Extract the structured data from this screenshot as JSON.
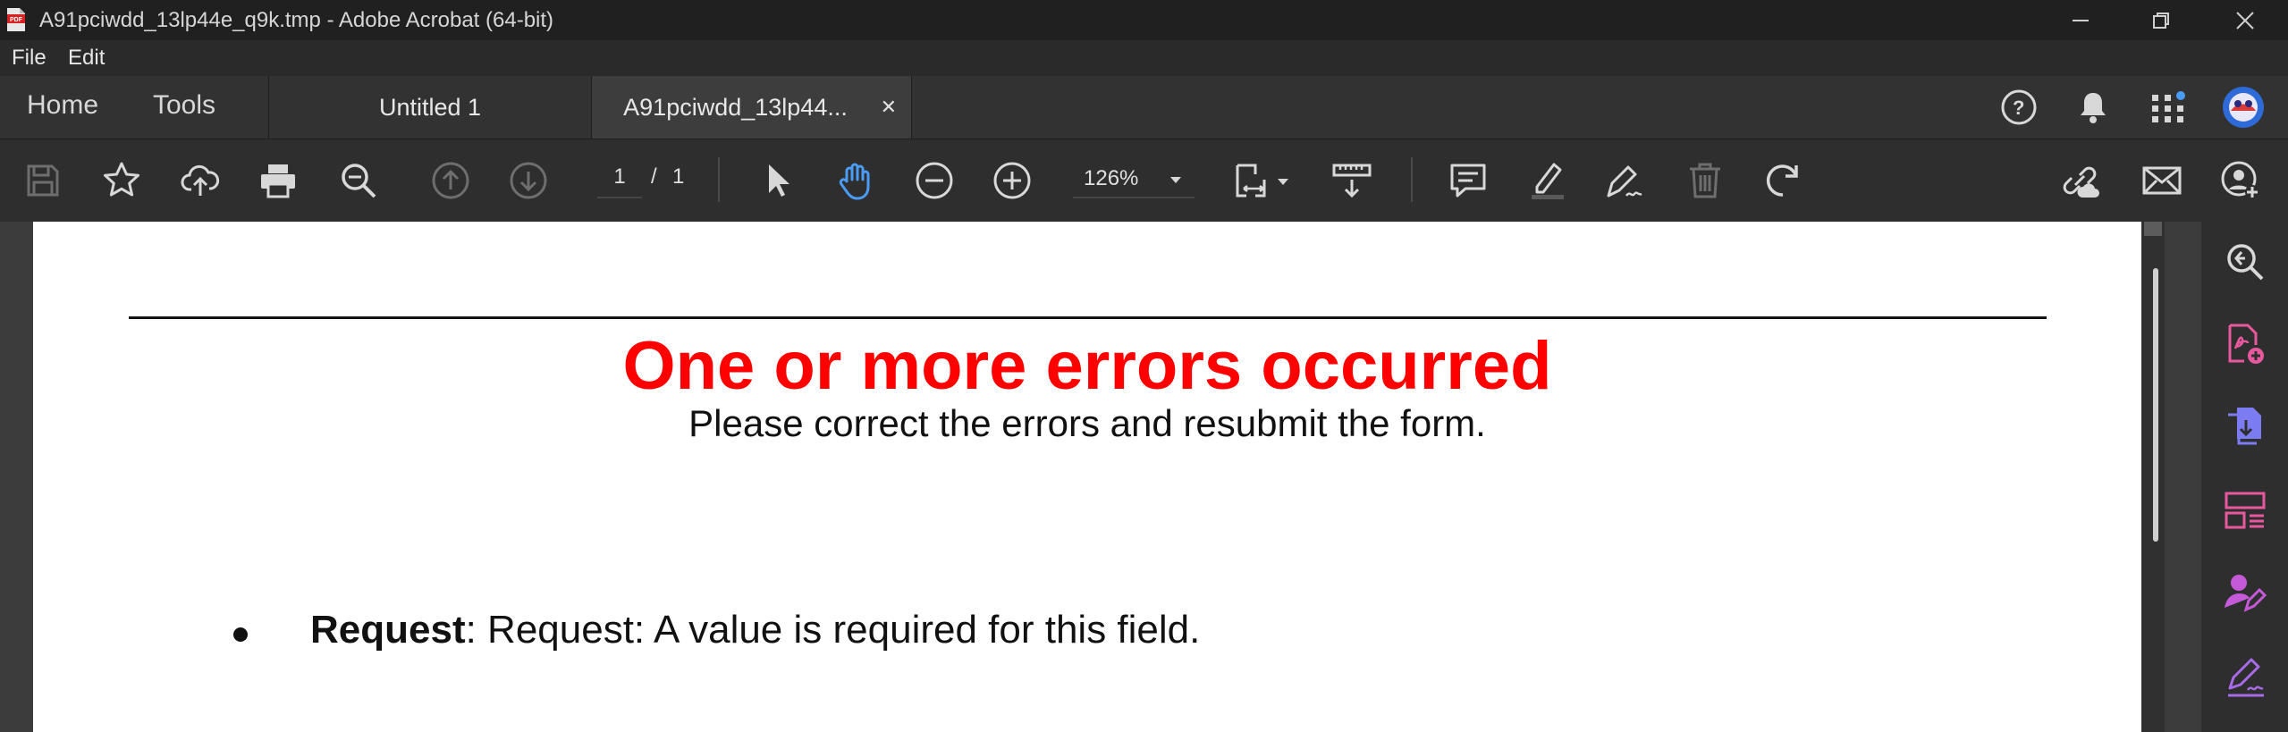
{
  "window": {
    "title": "A91pciwdd_13lp44e_q9k.tmp - Adobe Acrobat (64-bit)"
  },
  "menu": {
    "file": "File",
    "edit": "Edit"
  },
  "nav": {
    "home": "Home",
    "tools": "Tools"
  },
  "tabs": [
    {
      "label": "Untitled 1",
      "active": false
    },
    {
      "label": "A91pciwdd_13lp44...",
      "active": true
    }
  ],
  "toolbar": {
    "current_page": "1",
    "page_separator": "/",
    "total_pages": "1",
    "zoom": "126%"
  },
  "icons": {
    "toolbar": [
      "save-icon",
      "bookmark-star-icon",
      "upload-cloud-icon",
      "print-icon",
      "zoom-search-icon",
      "prev-page-icon",
      "next-page-icon",
      "select-pointer-icon",
      "hand-tool-icon",
      "zoom-out-icon",
      "zoom-in-icon",
      "page-fit-icon",
      "measure-icon",
      "comment-icon",
      "highlight-icon",
      "sign-pen-icon",
      "delete-icon",
      "rotate-icon",
      "share-link-icon",
      "email-icon",
      "add-user-icon"
    ],
    "top": [
      "help-icon",
      "notifications-bell-icon",
      "apps-grid-icon",
      "user-avatar"
    ],
    "right_panel": [
      "zoom-page-icon",
      "create-pdf-icon",
      "export-pdf-icon",
      "organize-pages-icon",
      "request-signature-icon",
      "fill-sign-icon"
    ]
  },
  "document": {
    "heading": "One or more errors occurred",
    "subheading": "Please correct the errors and resubmit the form.",
    "errors": [
      {
        "field": "Request",
        "message": ": Request: A value is required for this field."
      }
    ]
  },
  "colors": {
    "error_red": "#ff0000",
    "accent_blue": "#4a9cf6",
    "tool_pink": "#e8589e",
    "tool_purple": "#a86be8",
    "tool_blue": "#7c7cf2"
  }
}
